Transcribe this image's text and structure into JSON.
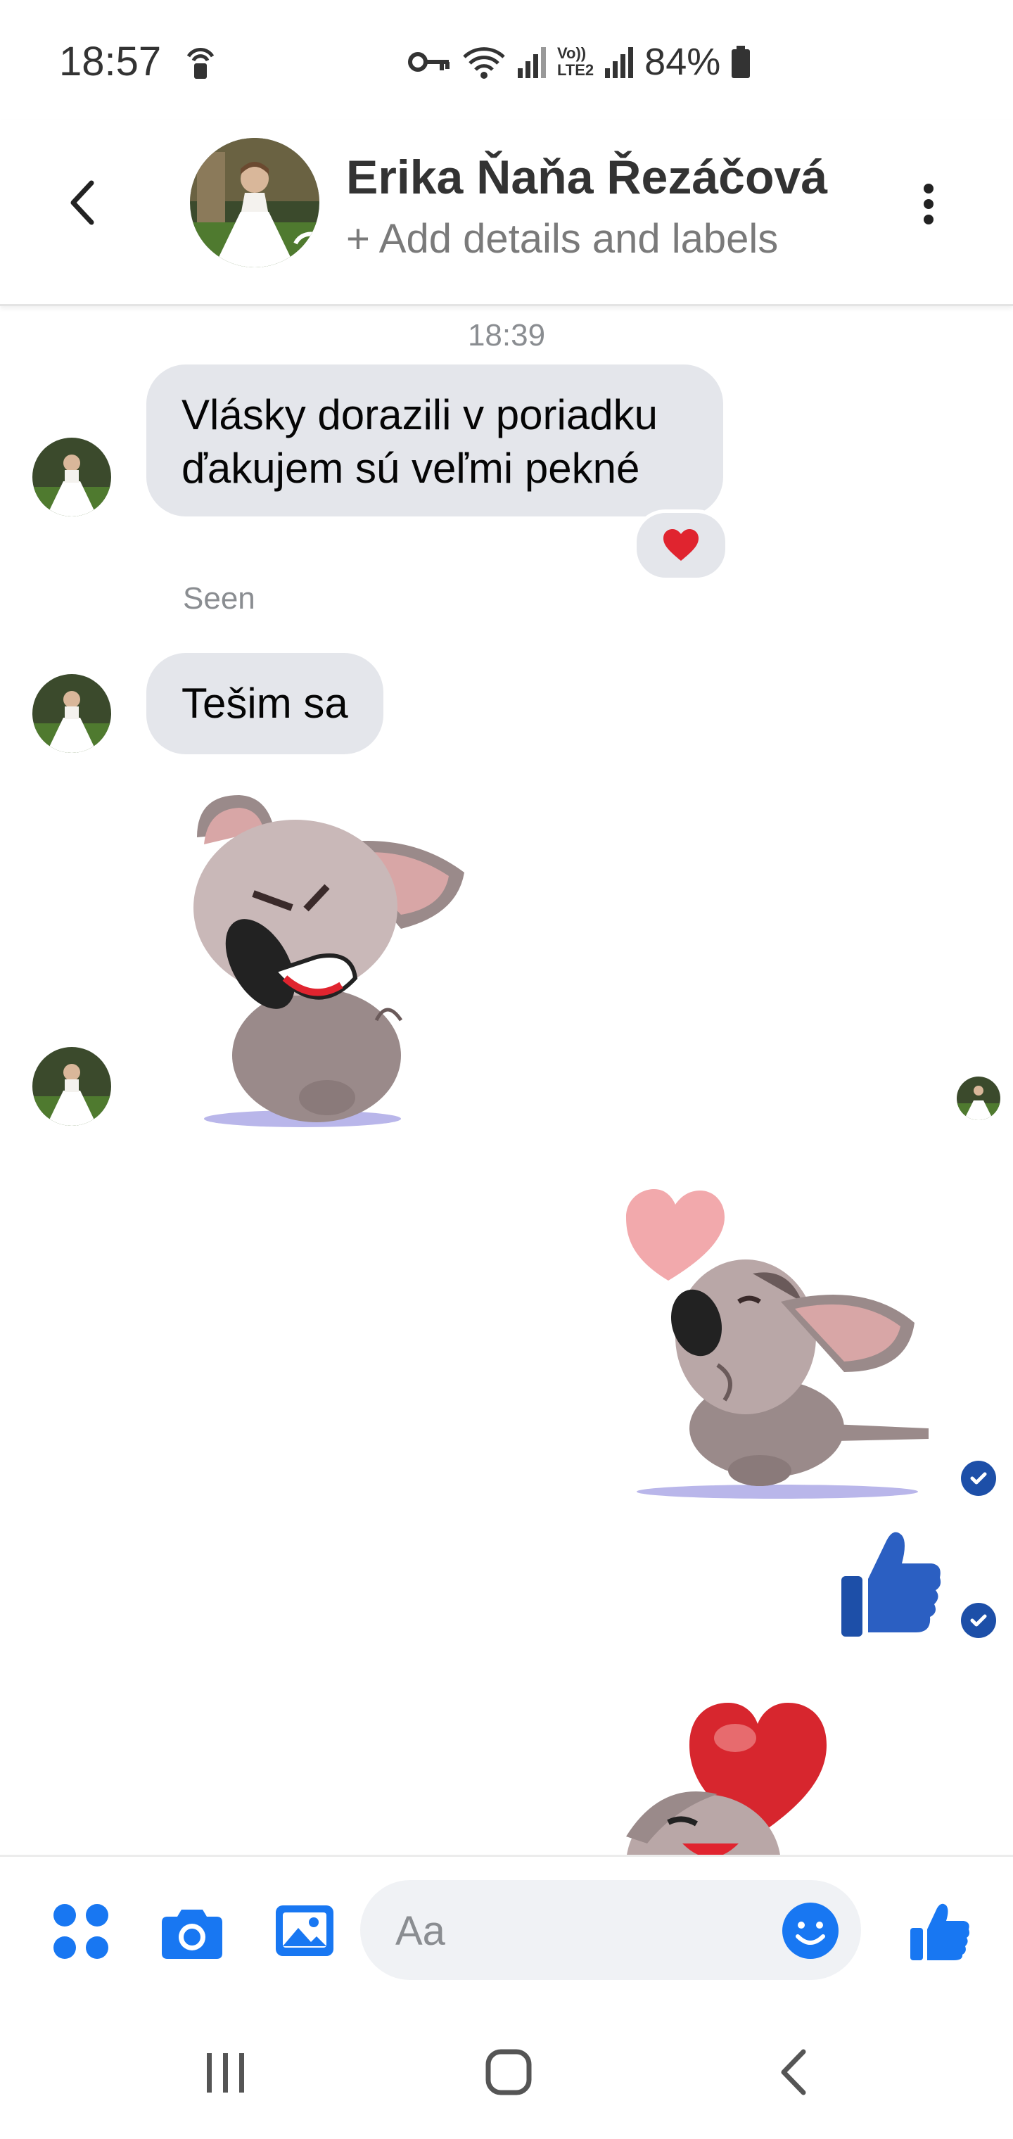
{
  "status_bar": {
    "time": "18:57",
    "volte_label": "Vo))",
    "lte_label": "LTE2",
    "battery": "84%"
  },
  "header": {
    "contact_name": "Erika Ňaňa Řezáčová",
    "subtitle": "+ Add details and labels"
  },
  "conversation": {
    "timestamp": "18:39",
    "messages": [
      {
        "sender": "contact",
        "text": "Vlásky dorazili v poriadku ďakujem sú veľmi pekné",
        "reaction": "❤️"
      },
      {
        "sender": "contact",
        "text": "Tešim sa"
      }
    ],
    "seen_label": "Seen"
  },
  "composer": {
    "placeholder": "Aa"
  },
  "colors": {
    "accent": "#1877f2",
    "bubble_gray": "#e4e6eb",
    "sent_check": "#1d4fa8",
    "heart_red": "#e0242f"
  },
  "icons": {
    "back": "back-arrow-icon",
    "more": "more-vertical-icon",
    "apps": "apps-grid-icon",
    "camera": "camera-icon",
    "gallery": "gallery-icon",
    "emoji": "emoji-icon",
    "like": "thumbs-up-icon"
  }
}
